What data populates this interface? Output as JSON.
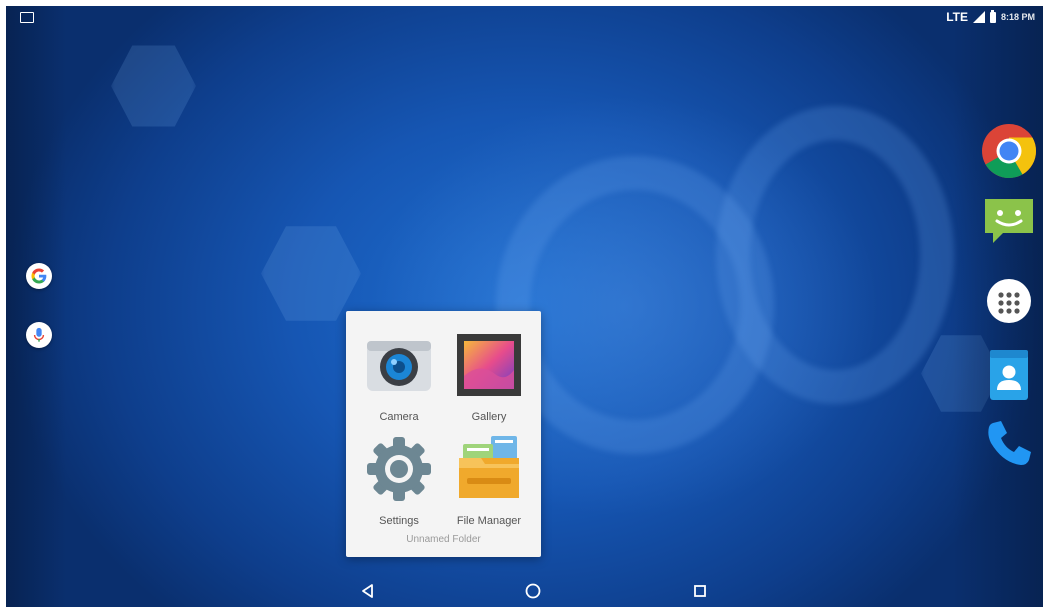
{
  "status_bar": {
    "network": "LTE",
    "time": "8:18 PM"
  },
  "left_shortcuts": [
    {
      "name": "Google Search",
      "icon": "google-icon"
    },
    {
      "name": "Voice Search",
      "icon": "mic-icon"
    }
  ],
  "dock": [
    {
      "name": "Chrome",
      "icon": "chrome-icon"
    },
    {
      "name": "Messaging",
      "icon": "messaging-icon"
    },
    {
      "name": "All Apps",
      "icon": "app-drawer-icon"
    },
    {
      "name": "Contacts",
      "icon": "contacts-icon"
    },
    {
      "name": "Phone",
      "icon": "phone-icon"
    }
  ],
  "folder": {
    "name": "Unnamed Folder",
    "apps": [
      {
        "label": "Camera",
        "icon": "camera-icon"
      },
      {
        "label": "Gallery",
        "icon": "gallery-icon"
      },
      {
        "label": "Settings",
        "icon": "settings-gear-icon"
      },
      {
        "label": "File Manager",
        "icon": "file-manager-icon"
      }
    ]
  },
  "navigation": [
    "back-icon",
    "home-icon",
    "recents-icon"
  ],
  "colors": {
    "wallpaper": "#1656b3",
    "folder_bg": "#f4f4f4",
    "chrome_red": "#db4437",
    "chrome_yellow": "#f4c20d",
    "chrome_green": "#0f9d58",
    "messaging_green": "#8bc34a",
    "contacts_blue": "#29a3e8"
  }
}
